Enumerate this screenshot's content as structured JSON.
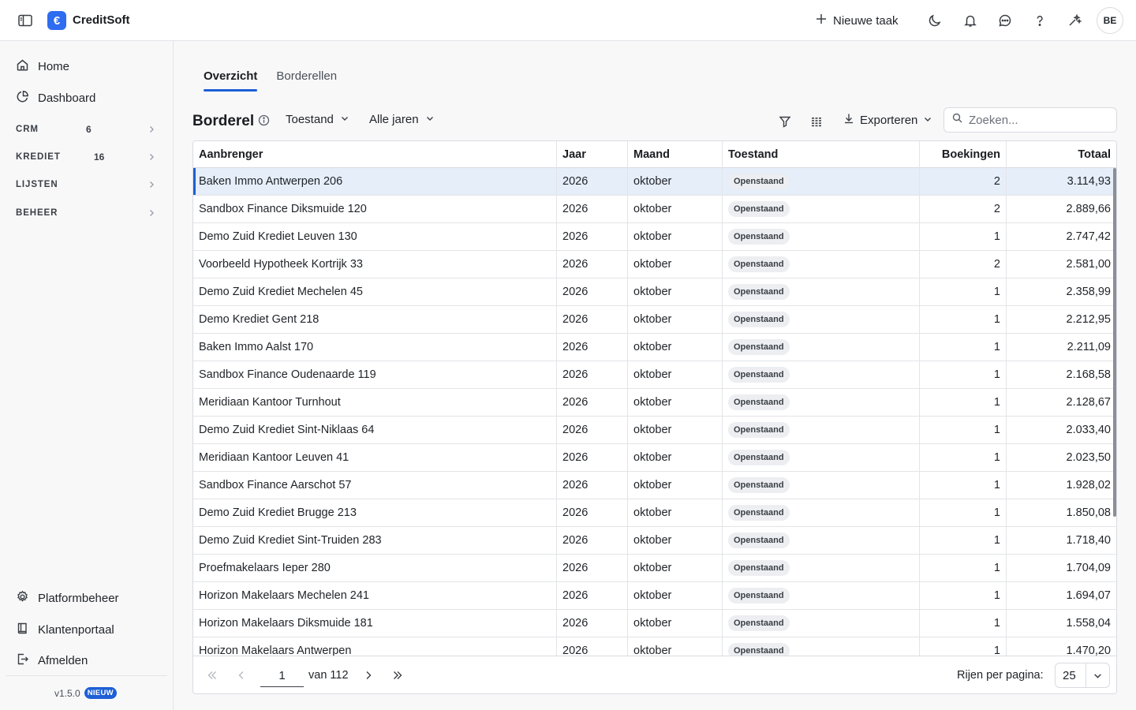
{
  "app": {
    "title": "CreditSoft",
    "logo_glyph": "€"
  },
  "header": {
    "new_task_label": "Nieuwe taak",
    "icons": [
      "moon-icon",
      "bell-icon",
      "chat-icon",
      "help-icon",
      "sparkle-icon"
    ],
    "avatar_initials": "BE"
  },
  "sidebar": {
    "nav": [
      {
        "label": "Home",
        "icon": "home-icon"
      },
      {
        "label": "Dashboard",
        "icon": "pie-chart-icon"
      }
    ],
    "sections": [
      {
        "label": "CRM",
        "count": "6"
      },
      {
        "label": "KREDIET",
        "count": "16"
      },
      {
        "label": "LIJSTEN",
        "count": ""
      },
      {
        "label": "BEHEER",
        "count": ""
      }
    ],
    "bottom": [
      {
        "label": "Platformbeheer",
        "icon": "gear-icon"
      },
      {
        "label": "Klantenportaal",
        "icon": "book-icon"
      },
      {
        "label": "Afmelden",
        "icon": "logout-icon"
      }
    ],
    "version": "v1.5.0",
    "version_badge": "NIEUW"
  },
  "main": {
    "tabs": [
      {
        "label": "Overzicht",
        "active": true
      },
      {
        "label": "Borderellen",
        "active": false
      }
    ],
    "toolbar": {
      "title": "Borderel",
      "filter_status_label": "Toestand",
      "filter_year_label": "Alle jaren",
      "export_label": "Exporteren",
      "search_placeholder": "Zoeken..."
    },
    "table": {
      "columns": [
        "Aanbrenger",
        "Jaar",
        "Maand",
        "Toestand",
        "Boekingen",
        "Totaal"
      ],
      "rows": [
        [
          "Baken Immo Antwerpen 206",
          "2026",
          "oktober",
          "Openstaand",
          "2",
          "3.114,93"
        ],
        [
          "Sandbox Finance Diksmuide 120",
          "2026",
          "oktober",
          "Openstaand",
          "2",
          "2.889,66"
        ],
        [
          "Demo Zuid Krediet Leuven 130",
          "2026",
          "oktober",
          "Openstaand",
          "1",
          "2.747,42"
        ],
        [
          "Voorbeeld Hypotheek Kortrijk 33",
          "2026",
          "oktober",
          "Openstaand",
          "2",
          "2.581,00"
        ],
        [
          "Demo Zuid Krediet Mechelen 45",
          "2026",
          "oktober",
          "Openstaand",
          "1",
          "2.358,99"
        ],
        [
          "Demo Krediet Gent 218",
          "2026",
          "oktober",
          "Openstaand",
          "1",
          "2.212,95"
        ],
        [
          "Baken Immo Aalst 170",
          "2026",
          "oktober",
          "Openstaand",
          "1",
          "2.211,09"
        ],
        [
          "Sandbox Finance Oudenaarde 119",
          "2026",
          "oktober",
          "Openstaand",
          "1",
          "2.168,58"
        ],
        [
          "Meridiaan Kantoor Turnhout",
          "2026",
          "oktober",
          "Openstaand",
          "1",
          "2.128,67"
        ],
        [
          "Demo Zuid Krediet Sint-Niklaas 64",
          "2026",
          "oktober",
          "Openstaand",
          "1",
          "2.033,40"
        ],
        [
          "Meridiaan Kantoor Leuven 41",
          "2026",
          "oktober",
          "Openstaand",
          "1",
          "2.023,50"
        ],
        [
          "Sandbox Finance Aarschot 57",
          "2026",
          "oktober",
          "Openstaand",
          "1",
          "1.928,02"
        ],
        [
          "Demo Zuid Krediet Brugge 213",
          "2026",
          "oktober",
          "Openstaand",
          "1",
          "1.850,08"
        ],
        [
          "Demo Zuid Krediet Sint-Truiden 283",
          "2026",
          "oktober",
          "Openstaand",
          "1",
          "1.718,40"
        ],
        [
          "Proefmakelaars Ieper 280",
          "2026",
          "oktober",
          "Openstaand",
          "1",
          "1.704,09"
        ],
        [
          "Horizon Makelaars Mechelen 241",
          "2026",
          "oktober",
          "Openstaand",
          "1",
          "1.694,07"
        ],
        [
          "Horizon Makelaars Diksmuide 181",
          "2026",
          "oktober",
          "Openstaand",
          "1",
          "1.558,04"
        ],
        [
          "Horizon Makelaars Antwerpen",
          "2026",
          "oktober",
          "Openstaand",
          "1",
          "1.470,20"
        ]
      ],
      "selected_row": 0
    },
    "pagination": {
      "current_page": "1",
      "of_label": "van 112",
      "rows_per_page_label": "Rijen per pagina:",
      "rows_per_page_value": "25"
    }
  },
  "colors": {
    "accent": "#1d5fd6",
    "logo": "#2e6cf0",
    "selected_row": "#e6eef9"
  }
}
